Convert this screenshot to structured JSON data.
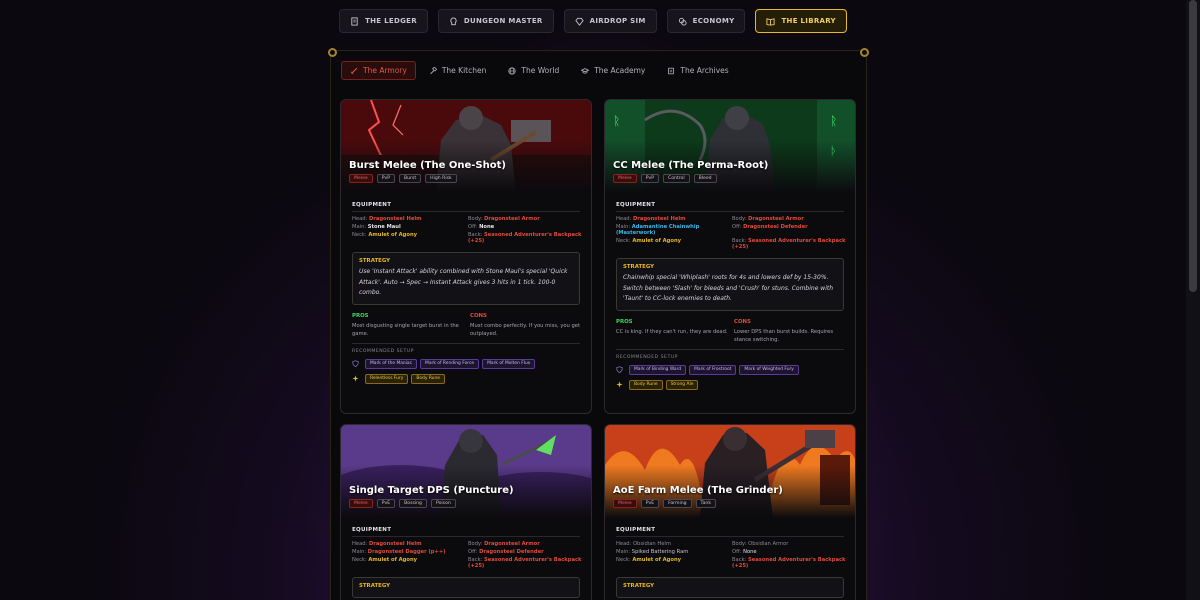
{
  "nav": [
    {
      "label": "THE LEDGER",
      "icon": "ledger-icon",
      "active": false
    },
    {
      "label": "DUNGEON MASTER",
      "icon": "skull-icon",
      "active": false
    },
    {
      "label": "AIRDROP SIM",
      "icon": "gem-icon",
      "active": false
    },
    {
      "label": "ECONOMY",
      "icon": "coins-icon",
      "active": false
    },
    {
      "label": "THE LIBRARY",
      "icon": "book-icon",
      "active": true
    }
  ],
  "subtabs": [
    {
      "label": "The Armory",
      "icon": "sword-icon",
      "active": true
    },
    {
      "label": "The Kitchen",
      "icon": "hammer-icon",
      "active": false
    },
    {
      "label": "The World",
      "icon": "globe-icon",
      "active": false
    },
    {
      "label": "The Academy",
      "icon": "cap-icon",
      "active": false
    },
    {
      "label": "The Archives",
      "icon": "scroll-icon",
      "active": false
    }
  ],
  "labels": {
    "equipment": "EQUIPMENT",
    "strategy": "STRATEGY",
    "pros": "PROS",
    "cons": "CONS",
    "recommended": "RECOMMENDED SETUP",
    "head": "Head:",
    "body": "Body:",
    "main": "Main:",
    "off": "Off:",
    "neck": "Neck:",
    "back": "Back:"
  },
  "colors": {
    "accent_gold": "#e5b92a",
    "active_red": "#e05a4a",
    "pros_green": "#3ed860",
    "cons_red": "#e44a3a"
  },
  "cards": [
    {
      "title": "Burst Melee (The One-Shot)",
      "tags": [
        "Melee",
        "PvP",
        "Burst",
        "High Risk"
      ],
      "equipment": {
        "head": "Dragonsteel Helm",
        "body": "Dragonsteel Armor",
        "main": "Stone Maul",
        "off": "None",
        "neck": "Amulet of Agony",
        "back": "Seasoned Adventurer's Backpack (+25)"
      },
      "strategy": "Use 'Instant Attack' ability combined with Stone Maul's special 'Quick Attack'. Auto → Spec → Instant Attack gives 3 hits in 1 tick. 100-0 combo.",
      "pros": "Most disgusting single target burst in the game.",
      "cons": "Must combo perfectly. If you miss, you get outplayed.",
      "marks": [
        "Mark of the Maniac",
        "Mark of Rending Force",
        "Mark of Molten Flux"
      ],
      "runes": [
        "Relentless Fury",
        "Body Rune"
      ]
    },
    {
      "title": "CC Melee (The Perma-Root)",
      "tags": [
        "Melee",
        "PvP",
        "Control",
        "Bleed"
      ],
      "equipment": {
        "head": "Dragonsteel Helm",
        "body": "Dragonsteel Armor",
        "main": "Adamantine Chainwhip (Masterwork)",
        "off": "Dragonsteel Defender",
        "neck": "Amulet of Agony",
        "back": "Seasoned Adventurer's Backpack (+25)"
      },
      "strategy": "Chainwhip special 'Whiplash' roots for 4s and lowers def by 15-30%. Switch between 'Slash' for bleeds and 'Crush' for stuns. Combine with 'Taunt' to CC-lock enemies to death.",
      "pros": "CC is king. If they can't run, they are dead.",
      "cons": "Lower DPS than burst builds. Requires stance switching.",
      "marks": [
        "Mark of Binding Ward",
        "Mark of Frostroot",
        "Mark of Weighted Fury"
      ],
      "runes": [
        "Body Rune",
        "Strong Ale"
      ]
    },
    {
      "title": "Single Target DPS (Puncture)",
      "tags": [
        "Melee",
        "PvE",
        "Bossing",
        "Poison"
      ],
      "equipment": {
        "head": "Dragonsteel Helm",
        "body": "Dragonsteel Armor",
        "main": "Dragonsteel Dagger (p++)",
        "off": "Dragonsteel Defender",
        "neck": "Amulet of Agony",
        "back": "Seasoned Adventurer's Backpack (+25)"
      },
      "strategy": "",
      "pros": "",
      "cons": "",
      "marks": [],
      "runes": []
    },
    {
      "title": "AoE Farm Melee (The Grinder)",
      "tags": [
        "Melee",
        "PvE",
        "Farming",
        "Tank"
      ],
      "equipment": {
        "head": "Obsidian Helm",
        "body": "Obsidian Armor",
        "main": "Spiked Battering Ram",
        "off": "None",
        "neck": "Amulet of Agony",
        "back": "Seasoned Adventurer's Backpack (+25)"
      },
      "strategy": "",
      "pros": "",
      "cons": "",
      "marks": [],
      "runes": []
    }
  ]
}
